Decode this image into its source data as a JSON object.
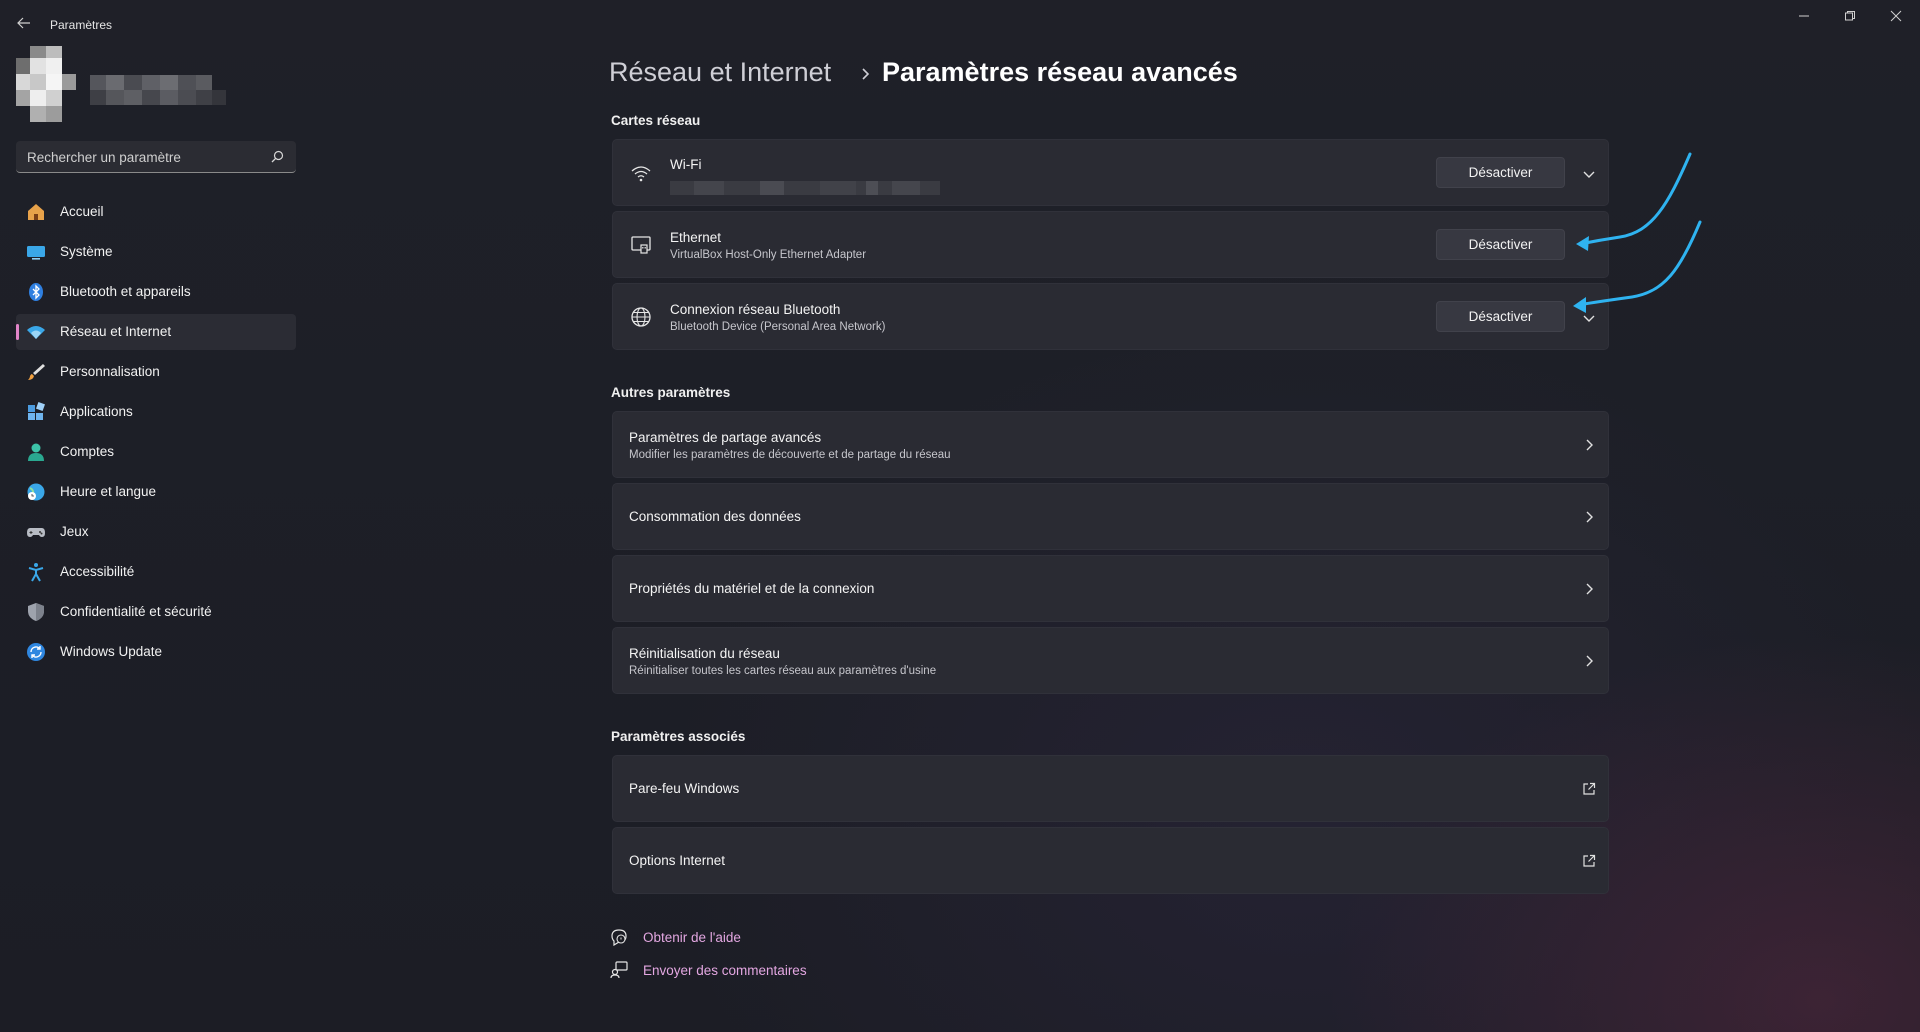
{
  "app": {
    "title": "Paramètres",
    "back_icon": "back-arrow-icon",
    "window_controls": [
      "minimize-icon",
      "maximize-icon",
      "close-icon"
    ]
  },
  "search": {
    "placeholder": "Rechercher un paramètre",
    "icon": "search-icon"
  },
  "sidebar": {
    "items": [
      {
        "label": "Accueil",
        "icon": "home-icon"
      },
      {
        "label": "Système",
        "icon": "display-icon"
      },
      {
        "label": "Bluetooth et appareils",
        "icon": "bluetooth-icon"
      },
      {
        "label": "Réseau et Internet",
        "icon": "wifi-icon",
        "active": true
      },
      {
        "label": "Personnalisation",
        "icon": "brush-icon"
      },
      {
        "label": "Applications",
        "icon": "apps-icon"
      },
      {
        "label": "Comptes",
        "icon": "person-icon"
      },
      {
        "label": "Heure et langue",
        "icon": "globe-clock-icon"
      },
      {
        "label": "Jeux",
        "icon": "gamepad-icon"
      },
      {
        "label": "Accessibilité",
        "icon": "accessibility-icon"
      },
      {
        "label": "Confidentialité et sécurité",
        "icon": "shield-icon"
      },
      {
        "label": "Windows Update",
        "icon": "update-icon"
      }
    ]
  },
  "breadcrumb": {
    "parent": "Réseau et Internet",
    "current": "Paramètres réseau avancés"
  },
  "network_adapters": {
    "heading": "Cartes réseau",
    "items": [
      {
        "name": "Wi-Fi",
        "description": "",
        "button": "Désactiver",
        "icon": "wifi-icon",
        "has_chevron": true
      },
      {
        "name": "Ethernet",
        "description": "VirtualBox Host-Only Ethernet Adapter",
        "button": "Désactiver",
        "icon": "ethernet-icon",
        "has_chevron": false
      },
      {
        "name": "Connexion réseau Bluetooth",
        "description": "Bluetooth Device (Personal Area Network)",
        "button": "Désactiver",
        "icon": "globe-icon",
        "has_chevron": true
      }
    ]
  },
  "other_settings": {
    "heading": "Autres paramètres",
    "items": [
      {
        "title": "Paramètres de partage avancés",
        "subtitle": "Modifier les paramètres de découverte et de partage du réseau"
      },
      {
        "title": "Consommation des données",
        "subtitle": ""
      },
      {
        "title": "Propriétés du matériel et de la connexion",
        "subtitle": ""
      },
      {
        "title": "Réinitialisation du réseau",
        "subtitle": "Réinitialiser toutes les cartes réseau aux paramètres d'usine"
      }
    ]
  },
  "related_settings": {
    "heading": "Paramètres associés",
    "items": [
      {
        "title": "Pare-feu Windows"
      },
      {
        "title": "Options Internet"
      }
    ]
  },
  "help": {
    "get_help": "Obtenir de l'aide",
    "feedback": "Envoyer des commentaires"
  },
  "colors": {
    "accent": "#e3a7e1",
    "annotation_arrow": "#2fb3f0",
    "background": "#1c1d24",
    "card": "#2a2b33"
  }
}
